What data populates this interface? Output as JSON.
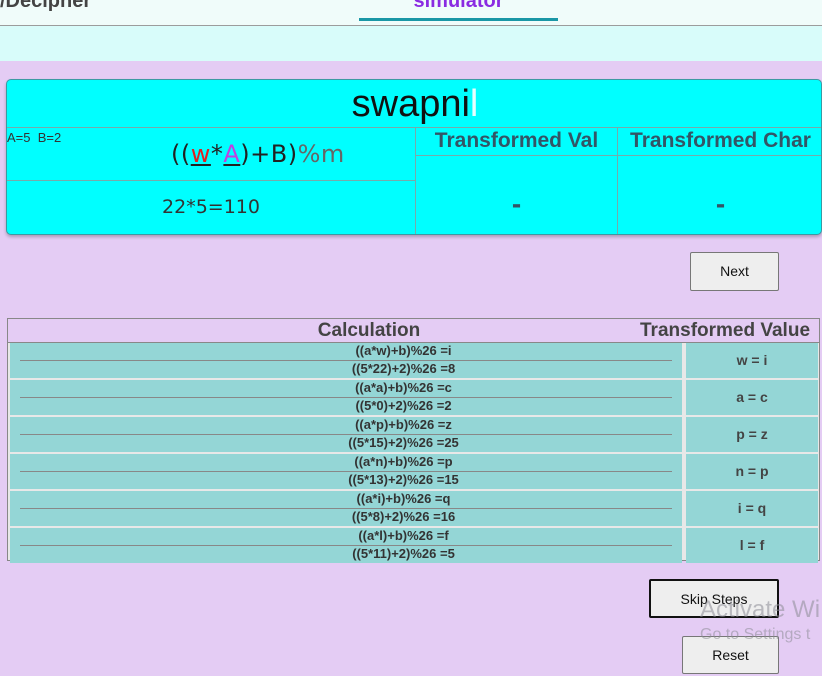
{
  "nav": {
    "left_tab": "/Decipher",
    "active_tab": "simulator"
  },
  "cipher": {
    "word_main": "swapni",
    "word_last": "l",
    "params": "A=5  B=2",
    "formula": {
      "open": "((",
      "var1": "w",
      "star": "*",
      "var2": "A",
      "close": ")+B)",
      "mod": "%m"
    },
    "calc": "22*5=110",
    "col_transformed_val": "Transformed Val",
    "col_transformed_char": "Transformed Char",
    "val_placeholder": "-",
    "char_placeholder": "-"
  },
  "buttons": {
    "next": "Next",
    "skip_steps": "Skip Steps",
    "reset": "Reset"
  },
  "steps": {
    "header_calc": "Calculation",
    "header_value": "Transformed Value",
    "rows": [
      {
        "l1": "((a*w)+b)%26 =i",
        "l2": "((5*22)+2)%26 =8",
        "val": "w = i"
      },
      {
        "l1": "((a*a)+b)%26 =c",
        "l2": "((5*0)+2)%26 =2",
        "val": "a = c"
      },
      {
        "l1": "((a*p)+b)%26 =z",
        "l2": "((5*15)+2)%26 =25",
        "val": "p = z"
      },
      {
        "l1": "((a*n)+b)%26 =p",
        "l2": "((5*13)+2)%26 =15",
        "val": "n = p"
      },
      {
        "l1": "((a*i)+b)%26 =q",
        "l2": "((5*8)+2)%26 =16",
        "val": "i = q"
      },
      {
        "l1": "((a*l)+b)%26 =f",
        "l2": "((5*11)+2)%26 =5",
        "val": "l = f"
      }
    ]
  },
  "watermark": {
    "line1": "Activate Wi",
    "line2": "Go to Settings t"
  }
}
